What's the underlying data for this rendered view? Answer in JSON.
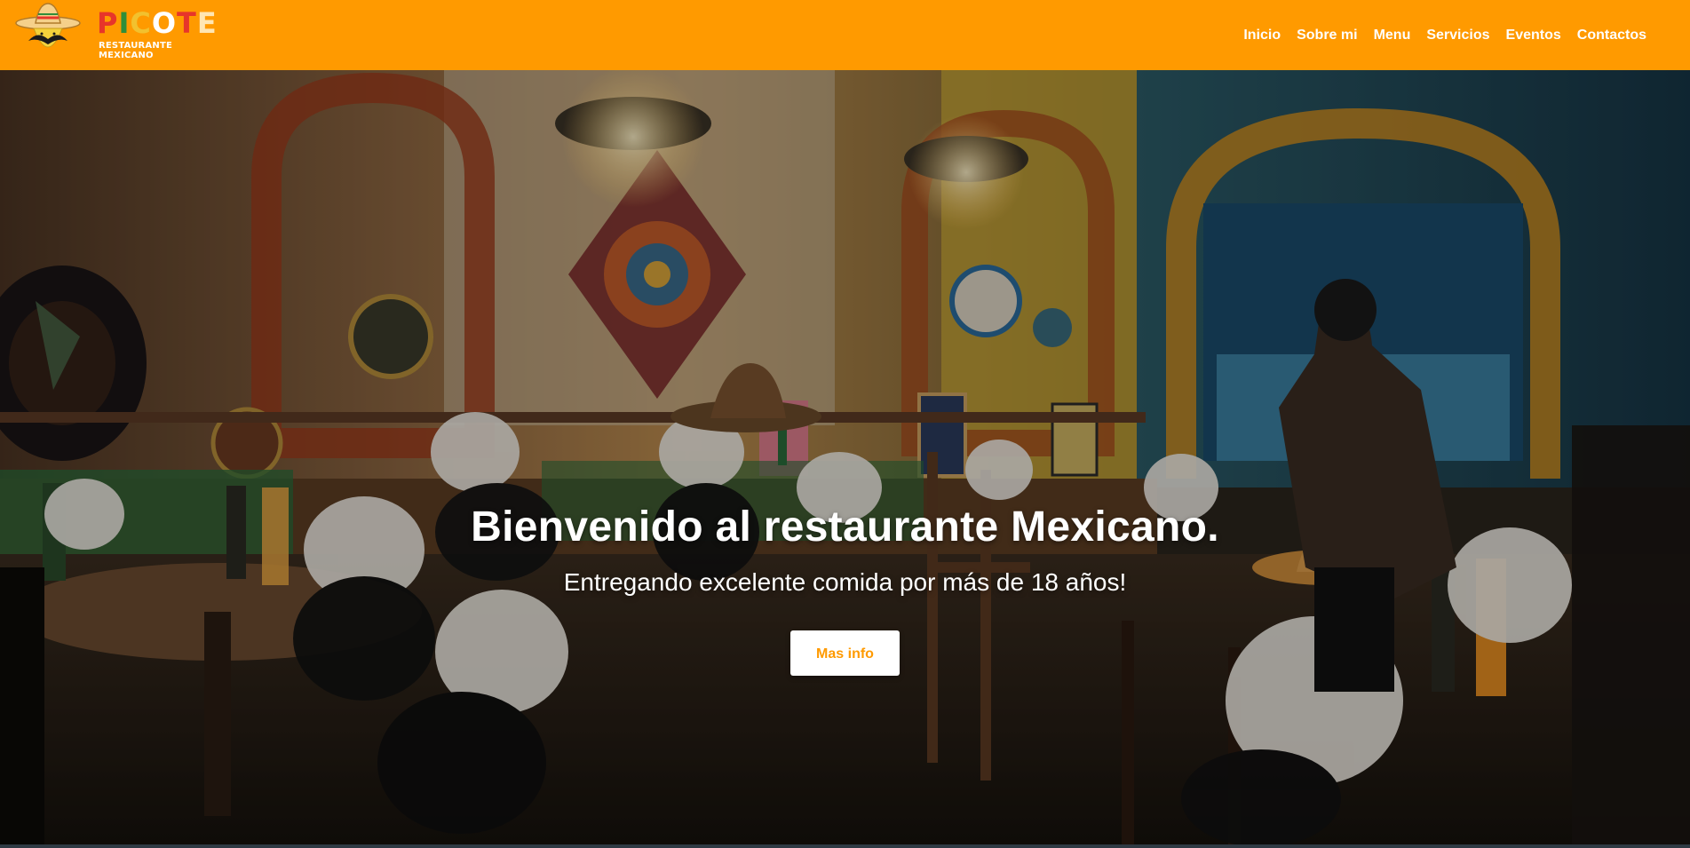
{
  "brand": {
    "name_letters": [
      "P",
      "I",
      "C",
      "O",
      "T",
      "E"
    ],
    "tagline": "RESTAURANTE MEXICANO",
    "logo_icon": "sombrero-mustache-icon",
    "colors": {
      "header": "#ff9a00",
      "button_text": "#ff9a00"
    }
  },
  "nav": {
    "items": [
      {
        "label": "Inicio"
      },
      {
        "label": "Sobre mi"
      },
      {
        "label": "Menu"
      },
      {
        "label": "Servicios"
      },
      {
        "label": "Eventos"
      },
      {
        "label": "Contactos"
      }
    ]
  },
  "hero": {
    "title": "Bienvenido al restaurante Mexicano.",
    "subtitle": "Entregando excelente comida por más de 18 años!",
    "button_label": "Mas info"
  }
}
